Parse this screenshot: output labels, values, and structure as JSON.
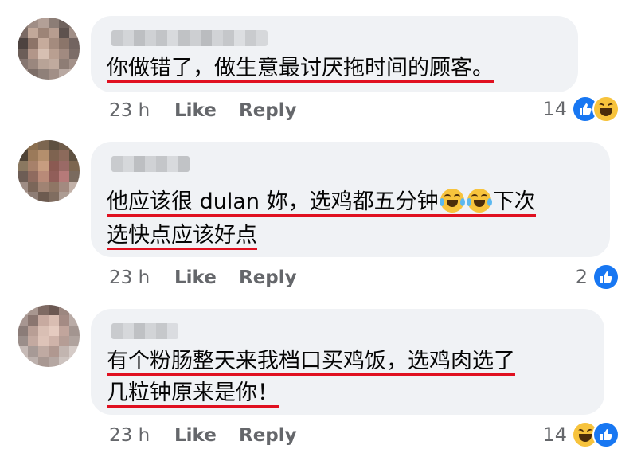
{
  "comments": [
    {
      "text_lines": [
        "你做错了，做生意最讨厌拖时间的顾客。"
      ],
      "time": "23 h",
      "like_label": "Like",
      "reply_label": "Reply",
      "reaction_count": "14",
      "reactions": [
        "like-icon",
        "haha-icon"
      ]
    },
    {
      "text_lines": [
        "他应该很 dulan 妳，选鸡都五分钟",
        "下次",
        "选快点应该好点"
      ],
      "time": "23 h",
      "like_label": "Like",
      "reply_label": "Reply",
      "reaction_count": "2",
      "reactions": [
        "like-icon"
      ]
    },
    {
      "text_lines": [
        "有个粉肠整天来我档口买鸡饭，选鸡肉选了",
        "几粒钟原来是你！"
      ],
      "time": "23 h",
      "like_label": "Like",
      "reply_label": "Reply",
      "reaction_count": "14",
      "reactions": [
        "haha-icon",
        "like-icon"
      ]
    }
  ]
}
